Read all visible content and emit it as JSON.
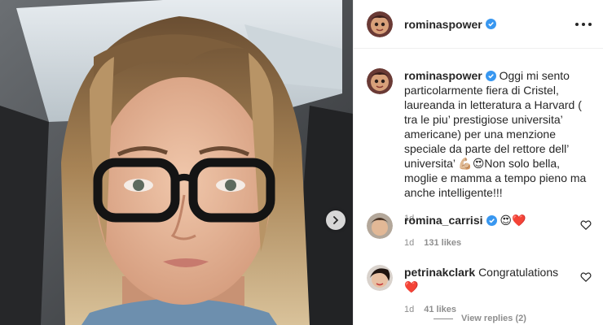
{
  "post": {
    "username": "rominaspower",
    "verified": true,
    "caption": "Oggi mi sento particolarmente fiera di Cristel, laureanda in letteratura a Harvard ( tra le piu’ prestigiose universita’ americane) per una menzione speciale da parte del rettore dell’ universita’ 💪🏼😍Non solo bella, moglie e mamma a tempo pieno ma anche intelligente!!!",
    "caption_age": "1d"
  },
  "comments": [
    {
      "username": "romina_carrisi",
      "verified": true,
      "text": "😍❤️",
      "age": "1d",
      "likes": "131 likes"
    },
    {
      "username": "petrinakclark",
      "verified": false,
      "text": "Congratulations ❤️",
      "age": "1d",
      "likes": "41 likes"
    }
  ],
  "view_replies": "View replies (2)",
  "icons": {
    "verified": "verified-badge-icon",
    "more": "more-options-icon",
    "next": "chevron-right-icon",
    "like": "heart-outline-icon"
  },
  "colors": {
    "verified": "#3897f0",
    "text": "#262626",
    "muted": "#8e8e8e"
  }
}
